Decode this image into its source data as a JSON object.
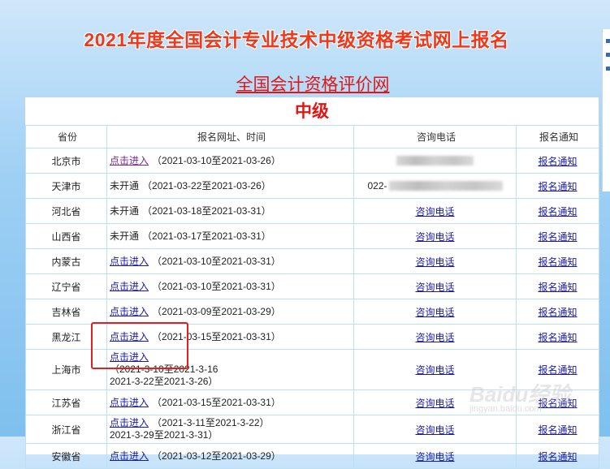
{
  "page": {
    "title": "2021年度全国会计专业技术中级资格考试网上报名",
    "site_link": "全国会计资格评价网",
    "level": "中级"
  },
  "table": {
    "headers": [
      "省份",
      "报名网址、时间",
      "咨询电话",
      "报名通知"
    ],
    "rows": [
      {
        "province": "北京市",
        "link": "点击进入",
        "lines": [
          "（2021-03-10至2021-03-26）"
        ],
        "phone": "",
        "phone_mode": "blur",
        "notice": "报名通知"
      },
      {
        "province": "天津市",
        "link": "",
        "status": "未开通",
        "lines": [
          "（2021-03-22至2021-03-26）"
        ],
        "phone": "022-",
        "phone_mode": "prefix-blur",
        "notice": "报名通知"
      },
      {
        "province": "河北省",
        "link": "",
        "status": "未开通",
        "lines": [
          "（2021-03-18至2021-03-31）"
        ],
        "phone": "咨询电话",
        "phone_mode": "link",
        "notice": "报名通知"
      },
      {
        "province": "山西省",
        "link": "",
        "status": "未开通",
        "lines": [
          "（2021-03-17至2021-03-31）"
        ],
        "phone": "咨询电话",
        "phone_mode": "link",
        "notice": "报名通知"
      },
      {
        "province": "内蒙古",
        "link": "点击进入",
        "lines": [
          "（2021-03-10至2021-03-31）"
        ],
        "phone": "咨询电话",
        "phone_mode": "link",
        "notice": "报名通知"
      },
      {
        "province": "辽宁省",
        "link": "点击进入",
        "lines": [
          "（2021-03-10至2021-03-31）"
        ],
        "phone": "咨询电话",
        "phone_mode": "link",
        "notice": "报名通知"
      },
      {
        "province": "吉林省",
        "link": "点击进入",
        "lines": [
          "（2021-03-09至2021-03-29）"
        ],
        "phone": "咨询电话",
        "phone_mode": "link",
        "notice": "报名通知"
      },
      {
        "province": "黑龙江",
        "link": "点击进入",
        "lines": [
          "（2021-03-15至2021-03-31）"
        ],
        "phone": "咨询电话",
        "phone_mode": "link",
        "notice": "报名通知"
      },
      {
        "province": "上海市",
        "link": "点击进入",
        "link_block": true,
        "lines": [
          "（2021-3-10至2021-3-16",
          "2021-3-22至2021-3-26）"
        ],
        "phone": "咨询电话",
        "phone_mode": "link",
        "notice": "报名通知"
      },
      {
        "province": "江苏省",
        "link": "点击进入",
        "lines": [
          "（2021-03-15至2021-03-31）"
        ],
        "phone": "咨询电话",
        "phone_mode": "link",
        "notice": "报名通知"
      },
      {
        "province": "浙江省",
        "link": "点击进入",
        "lines": [
          "（2021-3-11至2021-3-22）",
          "2021-3-29至2021-3-31）"
        ],
        "phone": "咨询电话",
        "phone_mode": "link",
        "notice": "报名通知"
      },
      {
        "province": "安徽省",
        "link": "点击进入",
        "lines": [
          "（2021-03-12至2021-03-29）"
        ],
        "phone": "咨询电话",
        "phone_mode": "link",
        "notice": "报名通知"
      }
    ]
  },
  "watermark": {
    "main": "Baidu经验",
    "sub": "jingyan.baidu.com"
  },
  "colors": {
    "title": "#ee3a1c",
    "link_red": "#e01616",
    "link_blue": "#1a1aa6",
    "border": "#bcdff3",
    "highlight_box": "#e02020"
  }
}
